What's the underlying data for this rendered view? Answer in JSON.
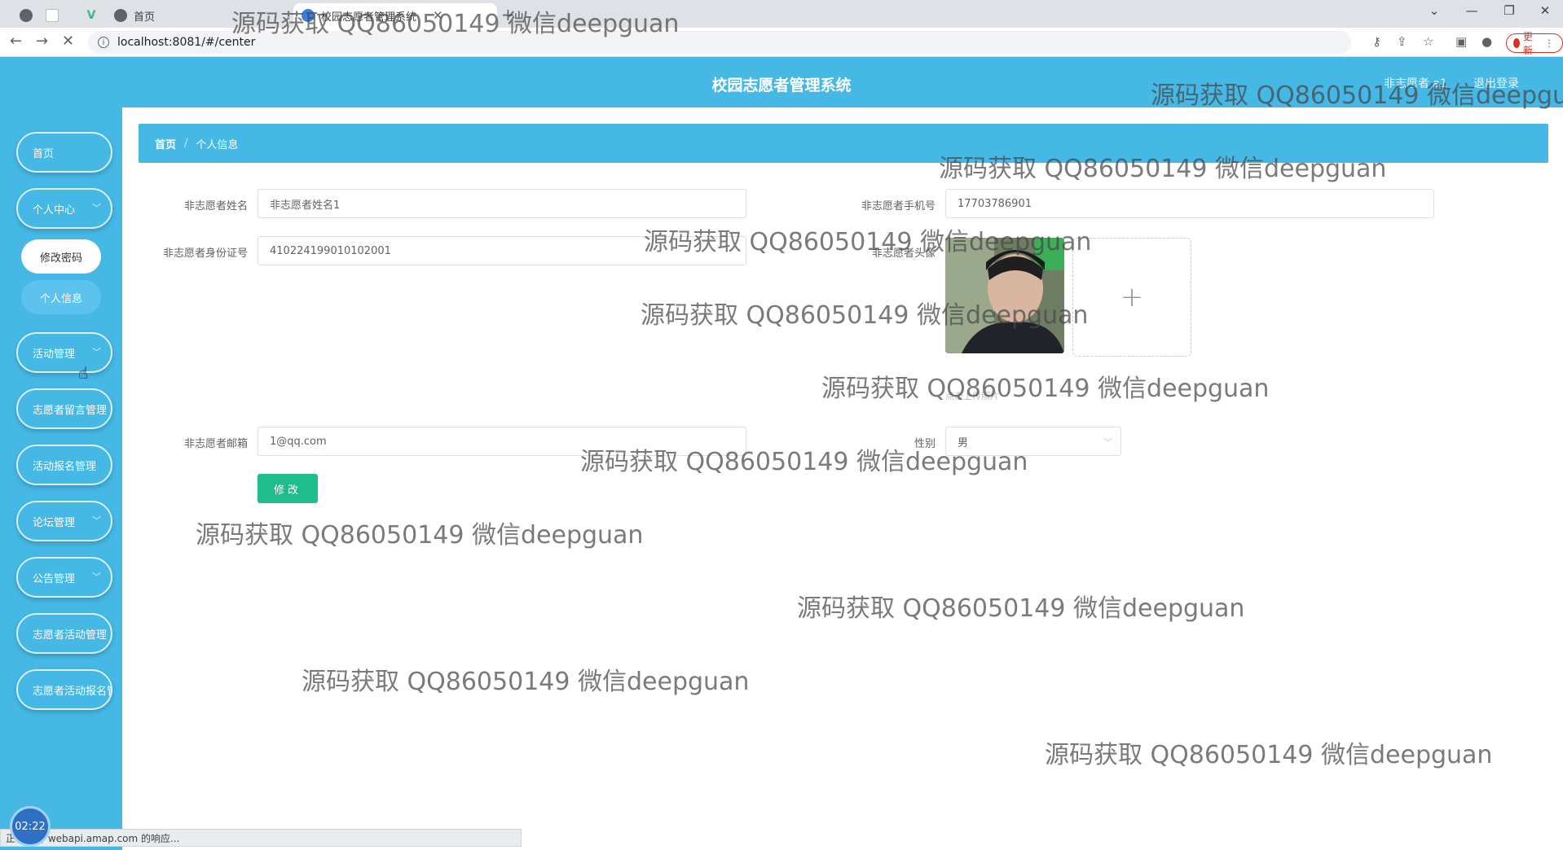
{
  "browser": {
    "tabs": [
      {
        "title": ""
      },
      {
        "title": ""
      },
      {
        "title": "首页"
      },
      {
        "title": "校园志愿者管理系统"
      }
    ],
    "url": "localhost:8081/#/center",
    "update_label": "更新"
  },
  "header": {
    "title": "校园志愿者管理系统",
    "user_label": "非志愿者 a1",
    "logout_label": "退出登录"
  },
  "sidebar": {
    "items": [
      {
        "label": "首页",
        "has_children": false
      },
      {
        "label": "个人中心",
        "has_children": true
      },
      {
        "label": "活动管理",
        "has_children": true
      },
      {
        "label": "志愿者留言管理",
        "has_children": false
      },
      {
        "label": "活动报名管理",
        "has_children": false
      },
      {
        "label": "论坛管理",
        "has_children": true
      },
      {
        "label": "公告管理",
        "has_children": true
      },
      {
        "label": "志愿者活动管理",
        "has_children": false
      },
      {
        "label": "志愿者活动报名管理",
        "has_children": false
      }
    ],
    "sub_items": [
      {
        "label": "修改密码",
        "active": true
      },
      {
        "label": "个人信息",
        "active": false
      }
    ]
  },
  "breadcrumb": {
    "home": "首页",
    "separator": "/",
    "current": "个人信息"
  },
  "form": {
    "name_label": "非志愿者姓名",
    "name_value": "非志愿者姓名1",
    "phone_label": "非志愿者手机号",
    "phone_value": "17703786901",
    "id_label": "非志愿者身份证号",
    "id_value": "410224199010102001",
    "avatar_label": "非志愿者头像",
    "upload_tip": "点击上传照片",
    "email_label": "非志愿者邮箱",
    "email_value": "1@qq.com",
    "gender_label": "性别",
    "gender_value": "男",
    "submit_label": "修改"
  },
  "status": {
    "clock": "02:22",
    "statusbar_text": "正在等待 webapi.amap.com 的响应..."
  },
  "watermark_text": "源码获取 QQ86050149 微信deepguan",
  "colors": {
    "primary": "#45b8e6",
    "submit": "#1fbc8c"
  }
}
